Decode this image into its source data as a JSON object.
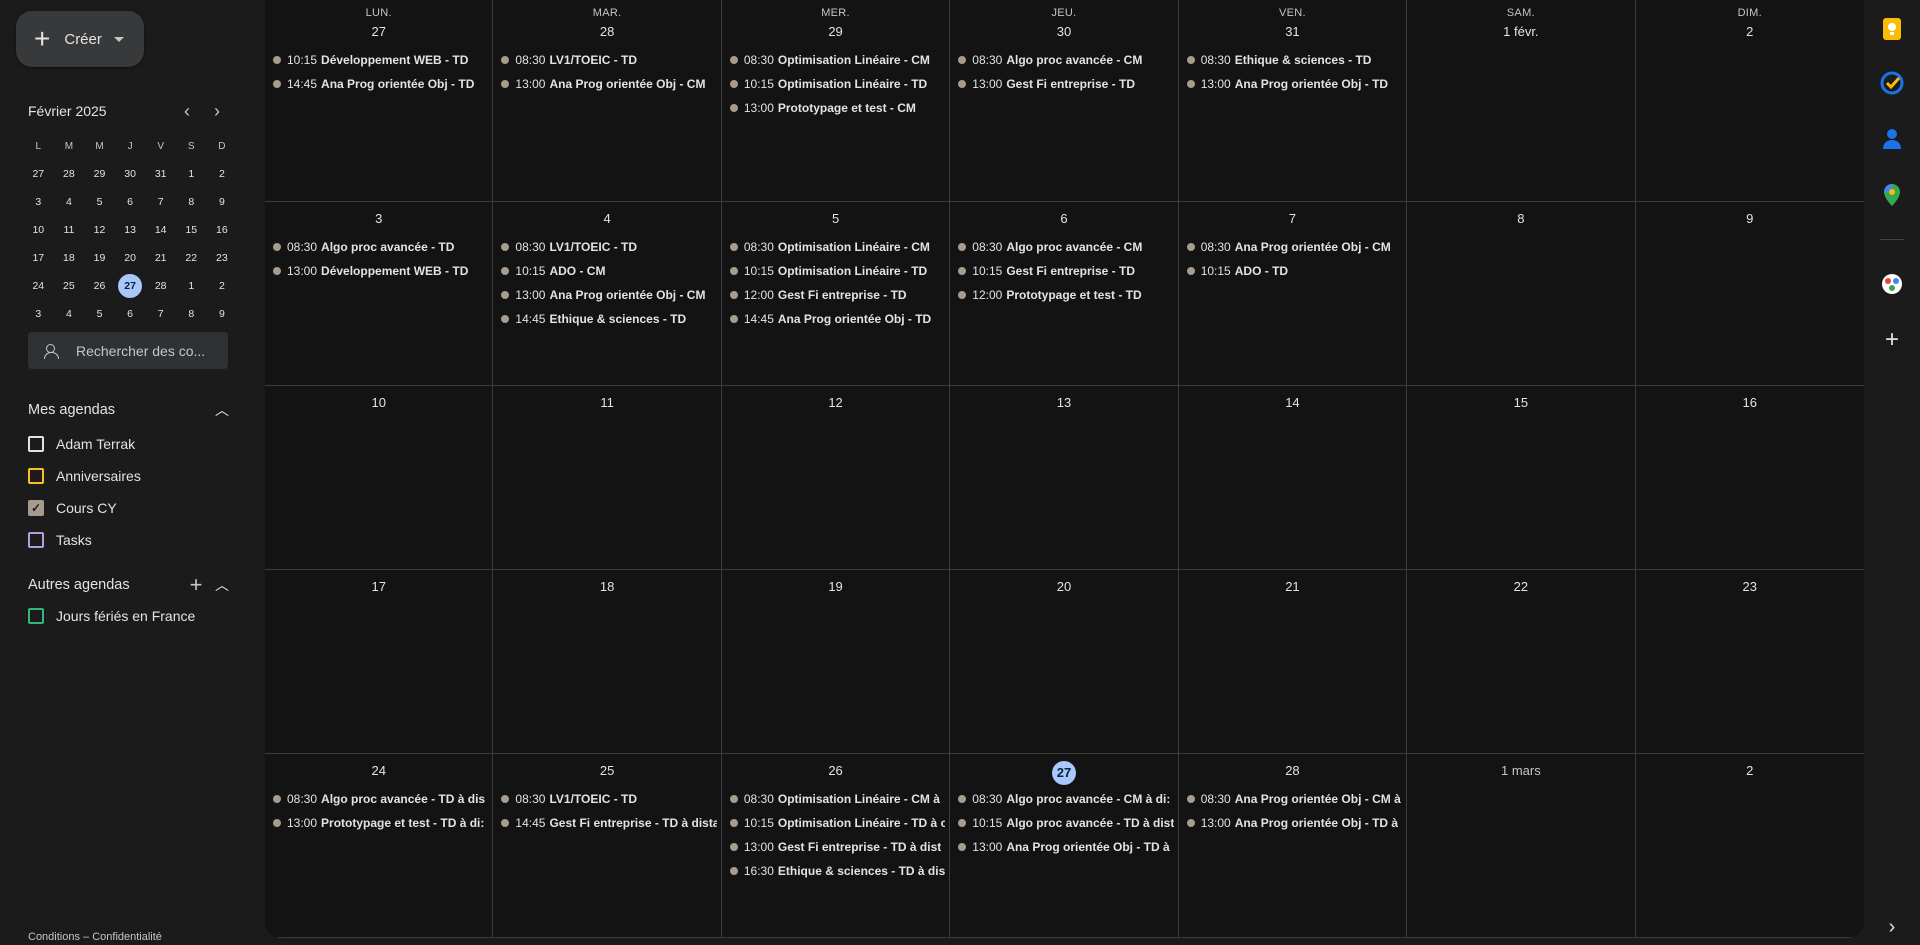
{
  "sidebar": {
    "create_label": "Créer",
    "mini_calendar": {
      "title": "Février 2025",
      "prev_icon": "chevron-left-icon",
      "next_icon": "chevron-right-icon",
      "weekdays": [
        "L",
        "M",
        "M",
        "J",
        "V",
        "S",
        "D"
      ],
      "weeks": [
        [
          "27",
          "28",
          "29",
          "30",
          "31",
          "1",
          "2"
        ],
        [
          "3",
          "4",
          "5",
          "6",
          "7",
          "8",
          "9"
        ],
        [
          "10",
          "11",
          "12",
          "13",
          "14",
          "15",
          "16"
        ],
        [
          "17",
          "18",
          "19",
          "20",
          "21",
          "22",
          "23"
        ],
        [
          "24",
          "25",
          "26",
          "27",
          "28",
          "1",
          "2"
        ],
        [
          "3",
          "4",
          "5",
          "6",
          "7",
          "8",
          "9"
        ]
      ],
      "today": "27"
    },
    "search_people_placeholder": "Rechercher des co...",
    "my_calendars": {
      "title": "Mes agendas",
      "items": [
        {
          "label": "Adam Terrak",
          "color": "#e3e3e3",
          "checked": false
        },
        {
          "label": "Anniversaires",
          "color": "#f6bf26",
          "checked": false
        },
        {
          "label": "Cours CY",
          "color": "#a79b8e",
          "checked": true
        },
        {
          "label": "Tasks",
          "color": "#b39ddb",
          "checked": false
        }
      ]
    },
    "other_calendars": {
      "title": "Autres agendas",
      "items": [
        {
          "label": "Jours fériés en France",
          "color": "#33b679",
          "checked": false
        }
      ]
    },
    "footer": "Conditions – Confidentialité"
  },
  "calendar": {
    "weekday_headers": [
      "LUN.",
      "MAR.",
      "MER.",
      "JEU.",
      "VEN.",
      "SAM.",
      "DIM."
    ],
    "event_color": "#a79b8e",
    "today_color": "#a8c7fa",
    "weeks": [
      [
        {
          "day": "27",
          "events": [
            {
              "time": "10:15",
              "title": "Développement WEB - TD"
            },
            {
              "time": "14:45",
              "title": "Ana Prog orientée Obj - TD"
            }
          ]
        },
        {
          "day": "28",
          "events": [
            {
              "time": "08:30",
              "title": "LV1/TOEIC - TD"
            },
            {
              "time": "13:00",
              "title": "Ana Prog orientée Obj - CM"
            }
          ]
        },
        {
          "day": "29",
          "events": [
            {
              "time": "08:30",
              "title": "Optimisation Linéaire - CM"
            },
            {
              "time": "10:15",
              "title": "Optimisation Linéaire - TD"
            },
            {
              "time": "13:00",
              "title": "Prototypage et test - CM"
            }
          ]
        },
        {
          "day": "30",
          "events": [
            {
              "time": "08:30",
              "title": "Algo proc avancée - CM"
            },
            {
              "time": "13:00",
              "title": "Gest Fi entreprise - TD"
            }
          ]
        },
        {
          "day": "31",
          "events": [
            {
              "time": "08:30",
              "title": "Ethique & sciences - TD"
            },
            {
              "time": "13:00",
              "title": "Ana Prog orientée Obj - TD"
            }
          ]
        },
        {
          "day": "1 févr.",
          "events": []
        },
        {
          "day": "2",
          "events": []
        }
      ],
      [
        {
          "day": "3",
          "events": [
            {
              "time": "08:30",
              "title": "Algo proc avancée - TD"
            },
            {
              "time": "13:00",
              "title": "Développement WEB - TD"
            }
          ]
        },
        {
          "day": "4",
          "events": [
            {
              "time": "08:30",
              "title": "LV1/TOEIC - TD"
            },
            {
              "time": "10:15",
              "title": "ADO - CM"
            },
            {
              "time": "13:00",
              "title": "Ana Prog orientée Obj - CM"
            },
            {
              "time": "14:45",
              "title": "Ethique & sciences - TD"
            }
          ]
        },
        {
          "day": "5",
          "events": [
            {
              "time": "08:30",
              "title": "Optimisation Linéaire - CM"
            },
            {
              "time": "10:15",
              "title": "Optimisation Linéaire - TD"
            },
            {
              "time": "12:00",
              "title": "Gest Fi entreprise - TD"
            },
            {
              "time": "14:45",
              "title": "Ana Prog orientée Obj - TD"
            }
          ]
        },
        {
          "day": "6",
          "events": [
            {
              "time": "08:30",
              "title": "Algo proc avancée - CM"
            },
            {
              "time": "10:15",
              "title": "Gest Fi entreprise - TD"
            },
            {
              "time": "12:00",
              "title": "Prototypage et test - TD"
            }
          ]
        },
        {
          "day": "7",
          "events": [
            {
              "time": "08:30",
              "title": "Ana Prog orientée Obj - CM"
            },
            {
              "time": "10:15",
              "title": "ADO - TD"
            }
          ]
        },
        {
          "day": "8",
          "events": []
        },
        {
          "day": "9",
          "events": []
        }
      ],
      [
        {
          "day": "10",
          "events": []
        },
        {
          "day": "11",
          "events": []
        },
        {
          "day": "12",
          "events": []
        },
        {
          "day": "13",
          "events": []
        },
        {
          "day": "14",
          "events": []
        },
        {
          "day": "15",
          "events": []
        },
        {
          "day": "16",
          "events": []
        }
      ],
      [
        {
          "day": "17",
          "events": []
        },
        {
          "day": "18",
          "events": []
        },
        {
          "day": "19",
          "events": []
        },
        {
          "day": "20",
          "events": []
        },
        {
          "day": "21",
          "events": []
        },
        {
          "day": "22",
          "events": []
        },
        {
          "day": "23",
          "events": []
        }
      ],
      [
        {
          "day": "24",
          "events": [
            {
              "time": "08:30",
              "title": "Algo proc avancée - TD à dis"
            },
            {
              "time": "13:00",
              "title": "Prototypage et test - TD à di:"
            }
          ]
        },
        {
          "day": "25",
          "events": [
            {
              "time": "08:30",
              "title": "LV1/TOEIC - TD"
            },
            {
              "time": "14:45",
              "title": "Gest Fi entreprise - TD à dista"
            }
          ]
        },
        {
          "day": "26",
          "events": [
            {
              "time": "08:30",
              "title": "Optimisation Linéaire - CM à"
            },
            {
              "time": "10:15",
              "title": "Optimisation Linéaire - TD à c"
            },
            {
              "time": "13:00",
              "title": "Gest Fi entreprise - TD à dist"
            },
            {
              "time": "16:30",
              "title": "Ethique & sciences - TD à dis"
            }
          ]
        },
        {
          "day": "27",
          "today": true,
          "events": [
            {
              "time": "08:30",
              "title": "Algo proc avancée - CM à di:"
            },
            {
              "time": "10:15",
              "title": "Algo proc avancée - TD à dist"
            },
            {
              "time": "13:00",
              "title": "Ana Prog orientée Obj - TD à"
            }
          ]
        },
        {
          "day": "28",
          "events": [
            {
              "time": "08:30",
              "title": "Ana Prog orientée Obj - CM à"
            },
            {
              "time": "13:00",
              "title": "Ana Prog orientée Obj - TD à"
            }
          ]
        },
        {
          "day": "1 mars",
          "muted": true,
          "events": []
        },
        {
          "day": "2",
          "events": []
        }
      ]
    ]
  },
  "right_rail": {
    "icons": [
      "keep-icon",
      "tasks-icon",
      "contacts-icon",
      "maps-icon",
      "add-on-icon",
      "add-icon",
      "expand-panel-icon"
    ],
    "colors": {
      "keep": "#fbbc04",
      "tasks": "#1a73e8",
      "contacts": "#1a73e8",
      "maps": "#34a853"
    }
  }
}
